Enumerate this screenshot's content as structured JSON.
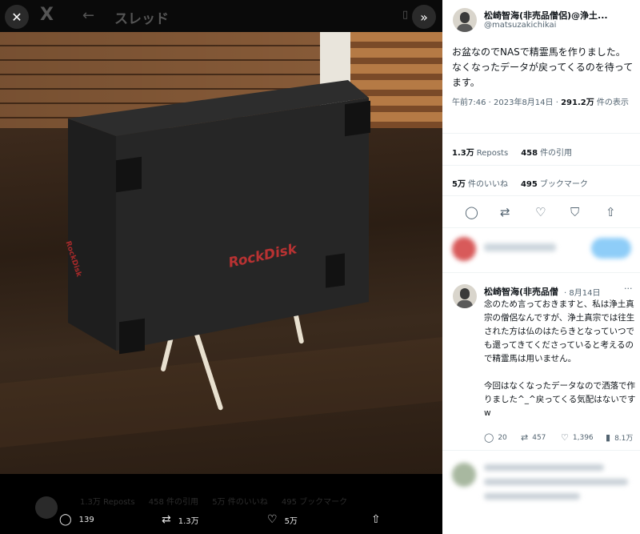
{
  "viewer": {
    "close_icon": "close-icon",
    "x_logo": "X",
    "back_icon": "back-arrow-icon",
    "thread_title": "スレッド",
    "expand_icon": "chevron-right-double-icon",
    "photo_logo_text": "RockDisk",
    "faded_stats": [
      "1.3万 Reposts",
      "458 件の引用",
      "5万 件のいいね",
      "495 ブックマーク"
    ],
    "actions": {
      "reply_count": "139",
      "repost_count": "1.3万",
      "like_count": "5万"
    }
  },
  "tweet": {
    "author_name": "松崎智海(非売品僧侶)@浄土...",
    "author_handle": "@matsuzakichikai",
    "text": "お盆なのでNASで精霊馬を作りました。なくなったデータが戻ってくるのを待ってます。",
    "time": "午前7:46 · 2023年8月14日 · ",
    "views_count": "291.2万",
    "views_label": " 件の表示",
    "reposts_count": "1.3万",
    "reposts_label": "Reposts",
    "quotes_count": "458",
    "quotes_label": "件の引用",
    "likes_count": "5万",
    "likes_label": "件のいいね",
    "bookmarks_count": "495",
    "bookmarks_label": "ブックマーク"
  },
  "reply": {
    "author_name": "松崎智海(非売品僧",
    "date": "· 8月14日",
    "more": "···",
    "text": "念のため言っておきますと、私は浄土真宗の僧侶なんですが、浄土真宗では往生された方は仏のはたらきとなっていつでも還ってきてくださっていると考えるので精霊馬は用いません。\n\n今回はなくなったデータなので洒落で作りました^_^戻ってくる気配はないですw",
    "reply_count": "20",
    "repost_count": "457",
    "like_count": "1,396",
    "views_count": "8.1万"
  }
}
